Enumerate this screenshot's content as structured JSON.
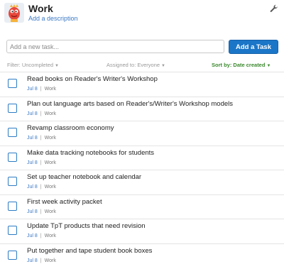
{
  "header": {
    "title": "Work",
    "add_description": "Add a description",
    "avatar_icon": "monster-avatar-icon",
    "settings_icon": "wrench-icon"
  },
  "new_task": {
    "placeholder": "Add a new task...",
    "button_label": "Add a Task"
  },
  "filters": {
    "completion": "Filter: Uncompleted",
    "assigned": "Assigned to: Everyone",
    "sort": "Sort by: Date created"
  },
  "tasks": [
    {
      "title": "Read books on Reader's Writer's Workshop",
      "date": "Jul 8",
      "list": "Work"
    },
    {
      "title": "Plan out language arts based on Reader's/Writer's Workshop models",
      "date": "Jul 8",
      "list": "Work"
    },
    {
      "title": "Revamp classroom economy",
      "date": "Jul 8",
      "list": "Work"
    },
    {
      "title": "Make data tracking notebooks for students",
      "date": "Jul 8",
      "list": "Work"
    },
    {
      "title": "Set up teacher notebook and calendar",
      "date": "Jul 8",
      "list": "Work"
    },
    {
      "title": "First week activity packet",
      "date": "Jul 8",
      "list": "Work"
    },
    {
      "title": "Update TpT products that need revision",
      "date": "Jul 8",
      "list": "Work"
    },
    {
      "title": "Put together and tape student book boxes",
      "date": "Jul 8",
      "list": "Work"
    }
  ],
  "colors": {
    "accent": "#1b76c8",
    "link": "#3b78c4",
    "sort_active": "#3b8a2e"
  }
}
